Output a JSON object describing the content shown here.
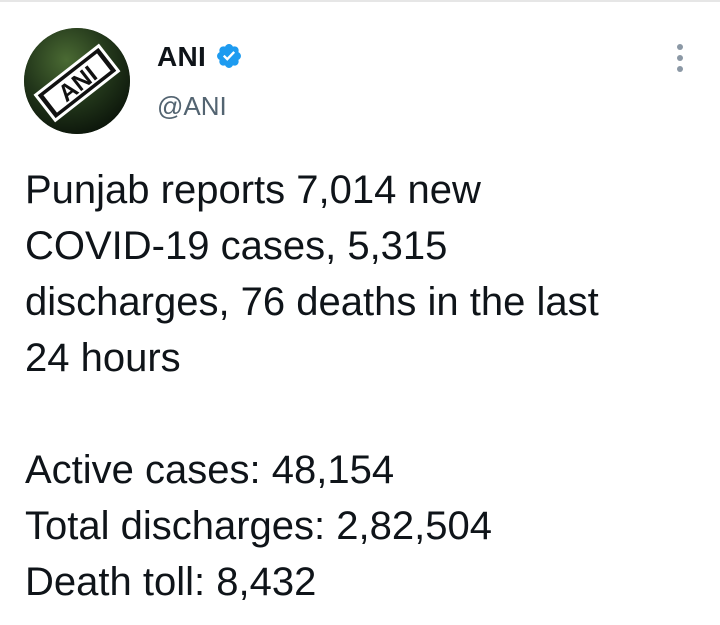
{
  "author": {
    "display_name": "ANI",
    "handle": "@ANI",
    "verified": true,
    "avatar_logo_text": "ANI",
    "avatar_icon": "ani-logo-avatar",
    "verified_icon": "verified-badge-icon"
  },
  "menu": {
    "icon": "more-vertical-icon"
  },
  "tweet": {
    "headline_lines": [
      "Punjab reports 7,014 new",
      "COVID-19 cases, 5,315",
      "discharges, 76 deaths in the last",
      "24 hours"
    ],
    "stats_lines": [
      "Active cases: 48,154",
      "Total discharges: 2,82,504",
      "Death toll: 8,432"
    ]
  },
  "colors": {
    "verified_blue": "#1d9bf0",
    "text": "#0f1419",
    "secondary_text": "#536471",
    "menu_dots": "#8b98a5"
  }
}
